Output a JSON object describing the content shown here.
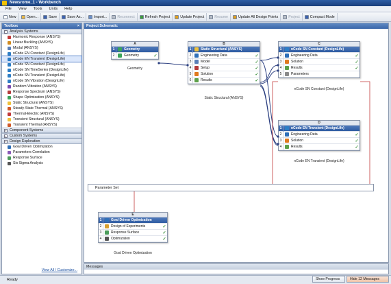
{
  "window": {
    "title": "Newsrome_1 - Workbench"
  },
  "menu": [
    "File",
    "View",
    "Tools",
    "Units",
    "Help"
  ],
  "toolbar": [
    {
      "label": "New",
      "icon": "new-icon",
      "enabled": true
    },
    {
      "label": "Open...",
      "icon": "open-icon",
      "enabled": true
    },
    {
      "label": "Save",
      "icon": "save-icon",
      "enabled": true
    },
    {
      "label": "Save As...",
      "icon": "save-as-icon",
      "enabled": true
    },
    {
      "label": "Import...",
      "icon": "import-icon",
      "enabled": true
    },
    {
      "label": "Reconnect",
      "icon": "reconnect-icon",
      "enabled": false
    },
    {
      "label": "Refresh Project",
      "icon": "refresh-icon",
      "enabled": true
    },
    {
      "label": "Update Project",
      "icon": "update-icon",
      "enabled": true
    },
    {
      "label": "Resume",
      "icon": "resume-icon",
      "enabled": false
    },
    {
      "label": "Update All Design Points",
      "icon": "update-all-icon",
      "enabled": true
    },
    {
      "label": "Project",
      "icon": "project-icon",
      "enabled": false
    },
    {
      "label": "Compact Mode",
      "icon": "compact-mode-icon",
      "enabled": true
    }
  ],
  "toolbox": {
    "title": "Toolbox",
    "groups": [
      {
        "label": "Analysis Systems",
        "expanded": true,
        "items": [
          "Harmonic Response (ANSYS)",
          "Linear Buckling (ANSYS)",
          "Modal (ANSYS)",
          "nCode EN Constant (DesignLife)",
          "nCode EN Transient (DesignLife)",
          "nCode SN Constant (DesignLife)",
          "nCode SN TimeSeries (DesignLife)",
          "nCode SN Transient (DesignLife)",
          "nCode SN Vibration (DesignLife)",
          "Random Vibration (ANSYS)",
          "Response Spectrum (ANSYS)",
          "Shape Optimization (ANSYS)",
          "Static Structural (ANSYS)",
          "Steady-State Thermal (ANSYS)",
          "Thermal-Electric (ANSYS)",
          "Transient Structural (ANSYS)",
          "Transient Thermal (ANSYS)"
        ]
      },
      {
        "label": "Component Systems",
        "expanded": false,
        "items": []
      },
      {
        "label": "Custom Systems",
        "expanded": false,
        "items": []
      },
      {
        "label": "Design Exploration",
        "expanded": true,
        "items": [
          "Goal Driven Optimization",
          "Parameters Correlation",
          "Response Surface",
          "Six Sigma Analysis"
        ]
      }
    ],
    "selected": "nCode EN Transient (DesignLife)",
    "view_all": "View All / Customize..."
  },
  "schematic": {
    "title": "Project Schematic",
    "blocks": [
      {
        "id": "A",
        "caption": "Geometry",
        "rows": [
          {
            "n": "1",
            "label": "Geometry",
            "icon": "geometry-icon",
            "status": ""
          },
          {
            "n": "2",
            "label": "Geometry",
            "icon": "geometry-icon",
            "status": "✓"
          }
        ]
      },
      {
        "id": "B",
        "caption": "Static Structural (ANSYS)",
        "rows": [
          {
            "n": "1",
            "label": "Static Structural (ANSYS)",
            "icon": "static-structural-icon",
            "status": ""
          },
          {
            "n": "2",
            "label": "Engineering Data",
            "icon": "engineering-data-icon",
            "status": "✓"
          },
          {
            "n": "3",
            "label": "Model",
            "icon": "model-icon",
            "status": "✓"
          },
          {
            "n": "4",
            "label": "Setup",
            "icon": "setup-icon",
            "status": "✓"
          },
          {
            "n": "5",
            "label": "Solution",
            "icon": "solution-icon",
            "status": "✓"
          },
          {
            "n": "6",
            "label": "Results",
            "icon": "results-icon",
            "status": "✓"
          }
        ]
      },
      {
        "id": "C",
        "caption": "nCode SN Constant (DesignLife)",
        "rows": [
          {
            "n": "1",
            "label": "nCode SN Constant (DesignLife)",
            "icon": "ncode-icon",
            "status": ""
          },
          {
            "n": "2",
            "label": "Engineering Data",
            "icon": "engineering-data-icon",
            "status": "✓"
          },
          {
            "n": "3",
            "label": "Solution",
            "icon": "solution-icon",
            "status": "✓"
          },
          {
            "n": "4",
            "label": "Results",
            "icon": "results-icon",
            "status": "✓"
          },
          {
            "n": "5",
            "label": "Parameters",
            "icon": "parameters-icon",
            "status": ""
          }
        ]
      },
      {
        "id": "D",
        "caption": "nCode EN Transient (DesignLife)",
        "rows": [
          {
            "n": "1",
            "label": "nCode EN Transient (DesignLife)",
            "icon": "ncode-icon",
            "status": ""
          },
          {
            "n": "2",
            "label": "Engineering Data",
            "icon": "engineering-data-icon",
            "status": "✓"
          },
          {
            "n": "3",
            "label": "Solution",
            "icon": "solution-icon",
            "status": "✓"
          },
          {
            "n": "4",
            "label": "Results",
            "icon": "results-icon",
            "status": "✓"
          }
        ]
      },
      {
        "id": "E",
        "caption": "Goal Driven Optimization",
        "rows": [
          {
            "n": "1",
            "label": "Goal Driven Optimization",
            "icon": "goal-driven-icon",
            "status": ""
          },
          {
            "n": "2",
            "label": "Design of Experiments",
            "icon": "doe-icon",
            "status": "✓"
          },
          {
            "n": "3",
            "label": "Response Surface",
            "icon": "response-surface-icon",
            "status": "✓"
          },
          {
            "n": "4",
            "label": "Optimization",
            "icon": "optimization-icon",
            "status": "✓"
          }
        ]
      }
    ],
    "parameter_set": "Parameter Set"
  },
  "messages": {
    "title": "Messages"
  },
  "status": {
    "text": "Ready",
    "show_progress": "Show Progress",
    "hide_messages": "Hide 12 Messages"
  },
  "colors": {
    "header_blue": "#2f5ca2",
    "link_line": "#2b3f80",
    "param_line": "#c23a3a"
  }
}
